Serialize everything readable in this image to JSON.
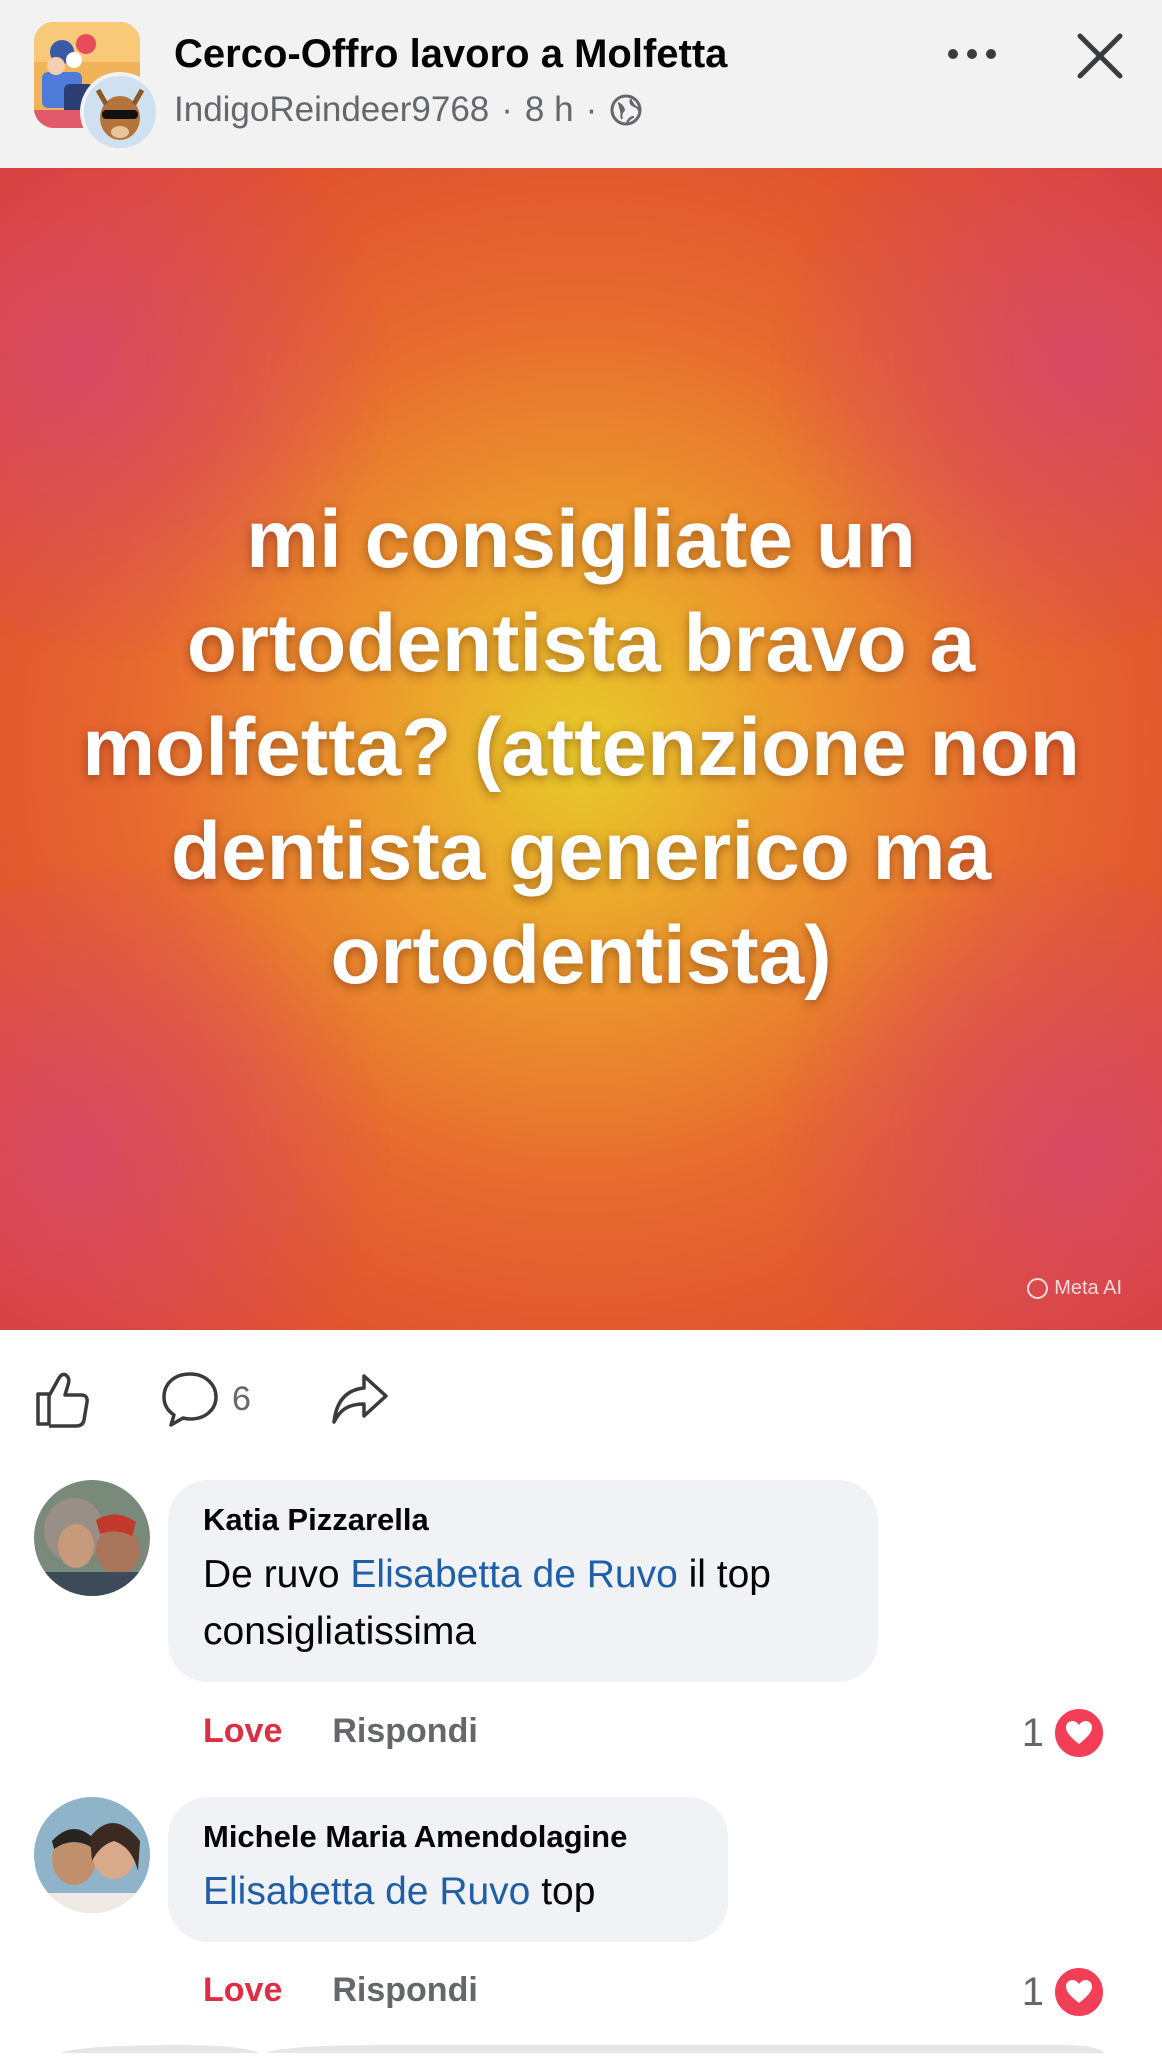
{
  "header": {
    "group_name": "Cerco-Offro lavoro a Molfetta",
    "author": "IndigoReindeer9768",
    "separator1": "·",
    "time": "8 h",
    "separator2": "·"
  },
  "post": {
    "text": "mi consigliate un ortodentista bravo a molfetta? (attenzione non dentista generico ma ortodentista)",
    "watermark": "Meta AI",
    "comment_count": "6"
  },
  "comments": [
    {
      "name": "Katia Pizzarella",
      "text_before": "De ruvo ",
      "mention": "Elisabetta de Ruvo",
      "text_after": " il top consigliatissima",
      "love_label": "Love",
      "reply_label": "Rispondi",
      "reaction_count": "1"
    },
    {
      "name": "Michele Maria Amendolagine",
      "text_before": "",
      "mention": "Elisabetta de Ruvo",
      "text_after": " top",
      "love_label": "Love",
      "reply_label": "Rispondi",
      "reaction_count": "1"
    }
  ],
  "icons": {
    "more": "more-horizontal-icon",
    "close": "close-icon",
    "globe": "globe-icon",
    "like": "thumbs-up-icon",
    "comment": "comment-bubble-icon",
    "share": "share-arrow-icon",
    "heart": "heart-icon"
  },
  "colors": {
    "mention": "#1f5ea8",
    "love": "#dd2e44",
    "heart_badge": "#f33e58",
    "secondary_text": "#65676b",
    "bubble": "#f0f2f5"
  }
}
